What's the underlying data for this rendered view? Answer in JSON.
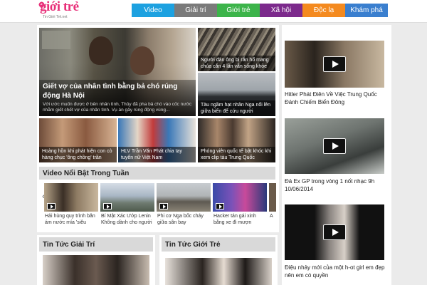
{
  "logo": {
    "main": "giới trẻ",
    "sub": "Tin Giới Trẻ.net"
  },
  "nav": [
    {
      "label": "Video",
      "color": "#1da1e0"
    },
    {
      "label": "Giải trí",
      "color": "#7a7a7a"
    },
    {
      "label": "Giới trẻ",
      "color": "#3cb44a"
    },
    {
      "label": "Xã hội",
      "color": "#7c2a8c"
    },
    {
      "label": "Độc lạ",
      "color": "#f48a1f"
    },
    {
      "label": "Khám phá",
      "color": "#3a7fcf"
    }
  ],
  "feature": {
    "title": "Giết vợ của nhân tình bằng bả chó rúng động Hà Nội",
    "summary": "Với ước muốn được ở bên nhân tình, Thủy đã pha bả chó vào cốc nước nhằm giết chết vợ của nhân tình. Vụ án gây rúng động vùng..."
  },
  "side_stories": [
    "Người đàn ông bị rắn hổ mang chúa cắn 4 lần vẫn sống khỏe",
    "Tàu ngầm hạt nhân Nga nổi lên giữa biển để cứu người"
  ],
  "row_stories": [
    "Hoàng hồn khi phát hiện con cò hàng chục 'ông chồng' trần",
    "HLV Trần Văn Phát chia tay tuyển nữ Việt Nam",
    "Phóng viên quốc tế bật khóc khi xem clip tàu Trung Quốc"
  ],
  "video_section": {
    "title": "Video Nổi Bật Trong Tuần",
    "prev_arrow": "‹",
    "next_arrow": "›",
    "items": [
      "Hải hùng quy trình bắn ám nước mía 'siêu",
      "Bí Mật Xác Ướp Lenin Không dành cho người",
      "Phi cơ Nga bốc cháy giữa sân bay",
      "Hacker tán gái xinh bằng xe đi mượn",
      "A"
    ]
  },
  "sections": {
    "left": "Tin Tức Giải Trí",
    "right": "Tin Tức Giới Trẻ"
  },
  "right_videos": [
    "Hitler Phát Điên Về Việc Trung Quốc Đánh Chiếm Biển Đông",
    "Đá Ex GP trong vòng 1 nốt nhạc 9h 10/06/2014",
    "Điệu nhảy mới của một h-ot girl em đẹp nên em có quyền"
  ]
}
